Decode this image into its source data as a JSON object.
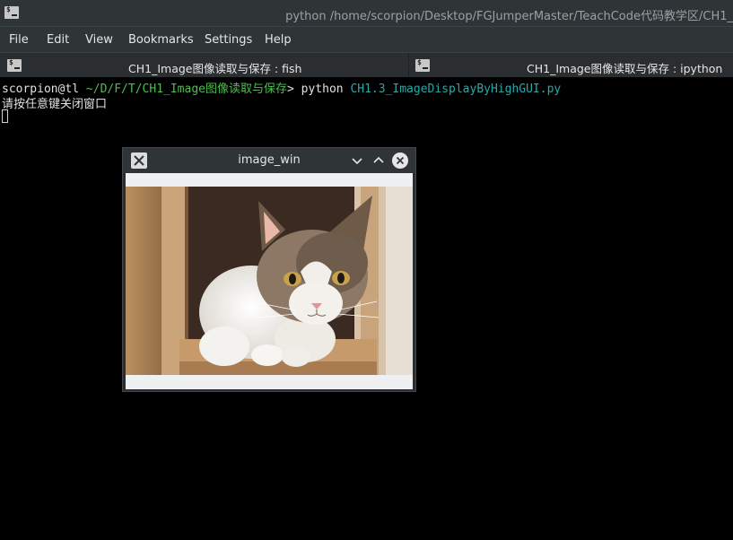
{
  "window": {
    "title": "python /home/scorpion/Desktop/FGJumperMaster/TeachCode代码教学区/CH1_"
  },
  "menu": [
    "File",
    "Edit",
    "View",
    "Bookmarks",
    "Settings",
    "Help"
  ],
  "tabs": [
    {
      "label": "CH1_Image图像读取与保存 : fish"
    },
    {
      "label": "CH1_Image图像读取与保存 : ipython"
    }
  ],
  "terminal": {
    "prompt_user": "scorpion@tl",
    "prompt_path": "~/D/F/T/CH1_Image图像读取与保存",
    "prompt_symbol": ">",
    "command": "python",
    "command_arg": "CH1.3_ImageDisplayByHighGUI.py",
    "output_line": "请按任意键关闭窗口"
  },
  "image_window": {
    "title": "image_win",
    "image_subject": "cat photo"
  },
  "icons": [
    "terminal-icon",
    "close-icon",
    "minimize-icon",
    "maximize-icon",
    "window-close-icon"
  ],
  "colors": {
    "path": "#4cbf4c",
    "argument": "#2aa8a8",
    "chrome": "#2f3437"
  }
}
